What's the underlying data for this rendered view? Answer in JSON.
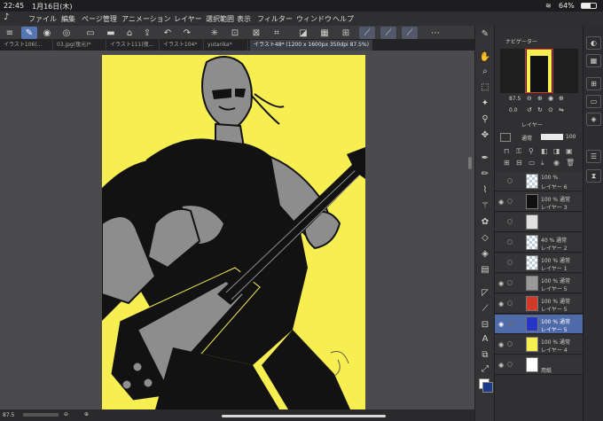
{
  "status_bar": {
    "time": "22:45",
    "date": "1月16日(木)",
    "battery": "64%"
  },
  "menu": {
    "app_icon": "clip-studio-icon",
    "items": [
      "ファイル",
      "編集",
      "ページ管理",
      "アニメーション",
      "レイヤー",
      "選択範囲",
      "表示",
      "フィルター",
      "ウィンドウ",
      "ヘルプ"
    ]
  },
  "command_bar": {
    "icons": [
      "menu-icon",
      "pen-select-icon",
      "fill-brush-icon",
      "new-file-icon",
      "open-folder-icon",
      "save-icon",
      "import-icon",
      "undo-icon",
      "redo-icon",
      "transform-icon",
      "deselect-icon",
      "invert-icon",
      "fit-icon",
      "snap-off-icon",
      "ruler-snap-icon",
      "special-ruler-icon",
      "grid-snap-icon",
      "dots-icon"
    ]
  },
  "tabs": [
    {
      "label": "イラスト106(…",
      "active": false
    },
    {
      "label": "03.jpg(復元)*",
      "active": false
    },
    {
      "label": "イラスト111(復…",
      "active": false
    },
    {
      "label": "イラスト104*",
      "active": false
    },
    {
      "label": "yutarika*",
      "active": false
    },
    {
      "label": "イラスト48* (1200 x 1600px 350dpi 87.5%)",
      "active": true
    }
  ],
  "bottom_bar": {
    "zoom": "87.5"
  },
  "navigator": {
    "title": "ナビゲーター",
    "zoom": "87.5",
    "rotation": "0.0"
  },
  "layer_panel": {
    "title": "レイヤー",
    "blend_mode": "通常",
    "opacity": "100",
    "layers": [
      {
        "l1": "100 %",
        "l2": "レイヤー 6",
        "visible": false,
        "thumb": "checker",
        "selected": false
      },
      {
        "l1": "100 % 通常",
        "l2": "レイヤー 3",
        "visible": true,
        "thumb": "#111111",
        "selected": false
      },
      {
        "l1": "",
        "l2": "",
        "visible": false,
        "thumb": "#e0e0e0",
        "selected": false
      },
      {
        "l1": "40 % 通常",
        "l2": "レイヤー 2",
        "visible": false,
        "thumb": "checker",
        "selected": false
      },
      {
        "l1": "100 % 通常",
        "l2": "レイヤー 1",
        "visible": false,
        "thumb": "checker",
        "selected": false
      },
      {
        "l1": "100 % 通常",
        "l2": "レイヤー 5",
        "visible": true,
        "thumb": "#999999",
        "selected": false
      },
      {
        "l1": "100 % 通常",
        "l2": "レイヤー 5",
        "visible": true,
        "thumb": "#d43a2a",
        "selected": false
      },
      {
        "l1": "100 % 通常",
        "l2": "レイヤー 5",
        "visible": true,
        "thumb": "#2436c8",
        "selected": true
      },
      {
        "l1": "100 % 通常",
        "l2": "レイヤー 4",
        "visible": true,
        "thumb": "#f7ee52",
        "selected": false
      },
      {
        "l1": "",
        "l2": "用紙",
        "visible": true,
        "thumb": "#ffffff",
        "selected": false
      }
    ]
  },
  "colors": {
    "canvas_bg": "#f7ee52",
    "accent": "#5774b3",
    "figure_gray": "#8d8d8d",
    "figure_black": "#121212"
  }
}
